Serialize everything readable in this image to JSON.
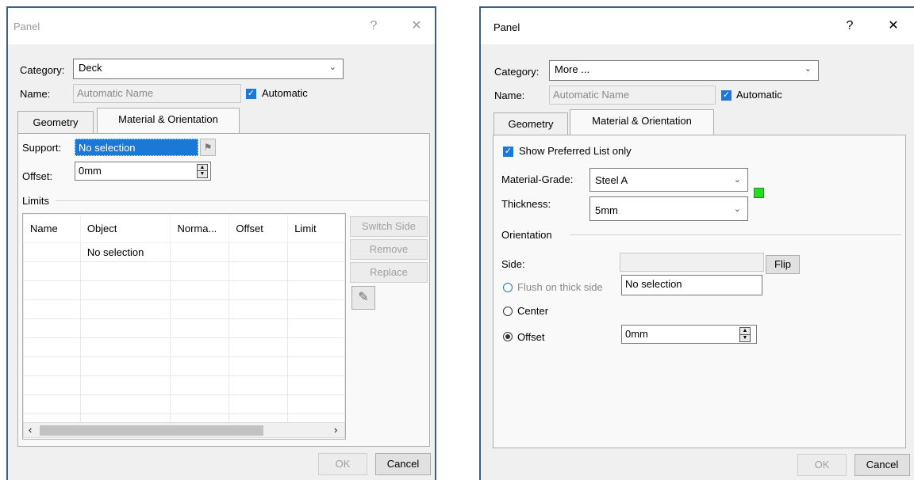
{
  "panel_left": {
    "title": "Panel",
    "help_glyph": "?",
    "close_glyph": "✕",
    "category_label": "Category:",
    "category_value": "Deck",
    "name_label": "Name:",
    "name_value": "Automatic Name",
    "automatic_label": "Automatic",
    "tabs": [
      "Geometry",
      "Material & Orientation"
    ],
    "support_label": "Support:",
    "support_value": "No selection",
    "offset_label": "Offset:",
    "offset_value": "0mm",
    "limits_label": "Limits",
    "table_columns": [
      "Name",
      "Object",
      "Norma...",
      "Offset",
      "Limit"
    ],
    "table_rows": [
      [
        "",
        "No selection",
        "",
        "",
        ""
      ]
    ],
    "buttons": {
      "switch_side": "Switch Side",
      "remove": "Remove",
      "replace": "Replace"
    },
    "ok_label": "OK",
    "cancel_label": "Cancel"
  },
  "panel_right": {
    "title": "Panel",
    "help_glyph": "?",
    "close_glyph": "✕",
    "category_label": "Category:",
    "category_value": "More ...",
    "name_label": "Name:",
    "name_value": "Automatic Name",
    "automatic_label": "Automatic",
    "tabs": [
      "Geometry",
      "Material & Orientation"
    ],
    "show_preferred_label": "Show Preferred List only",
    "material_grade_label": "Material-Grade:",
    "material_grade_value": "Steel A",
    "thickness_label": "Thickness:",
    "thickness_value": "5mm",
    "status_color": "#22dd22",
    "orientation_label": "Orientation",
    "side_label": "Side:",
    "flip_label": "Flip",
    "flush_label": "Flush on thick side",
    "flush_value": "No selection",
    "center_label": "Center",
    "offset_label": "Offset",
    "offset_value": "0mm",
    "ok_label": "OK",
    "cancel_label": "Cancel"
  }
}
